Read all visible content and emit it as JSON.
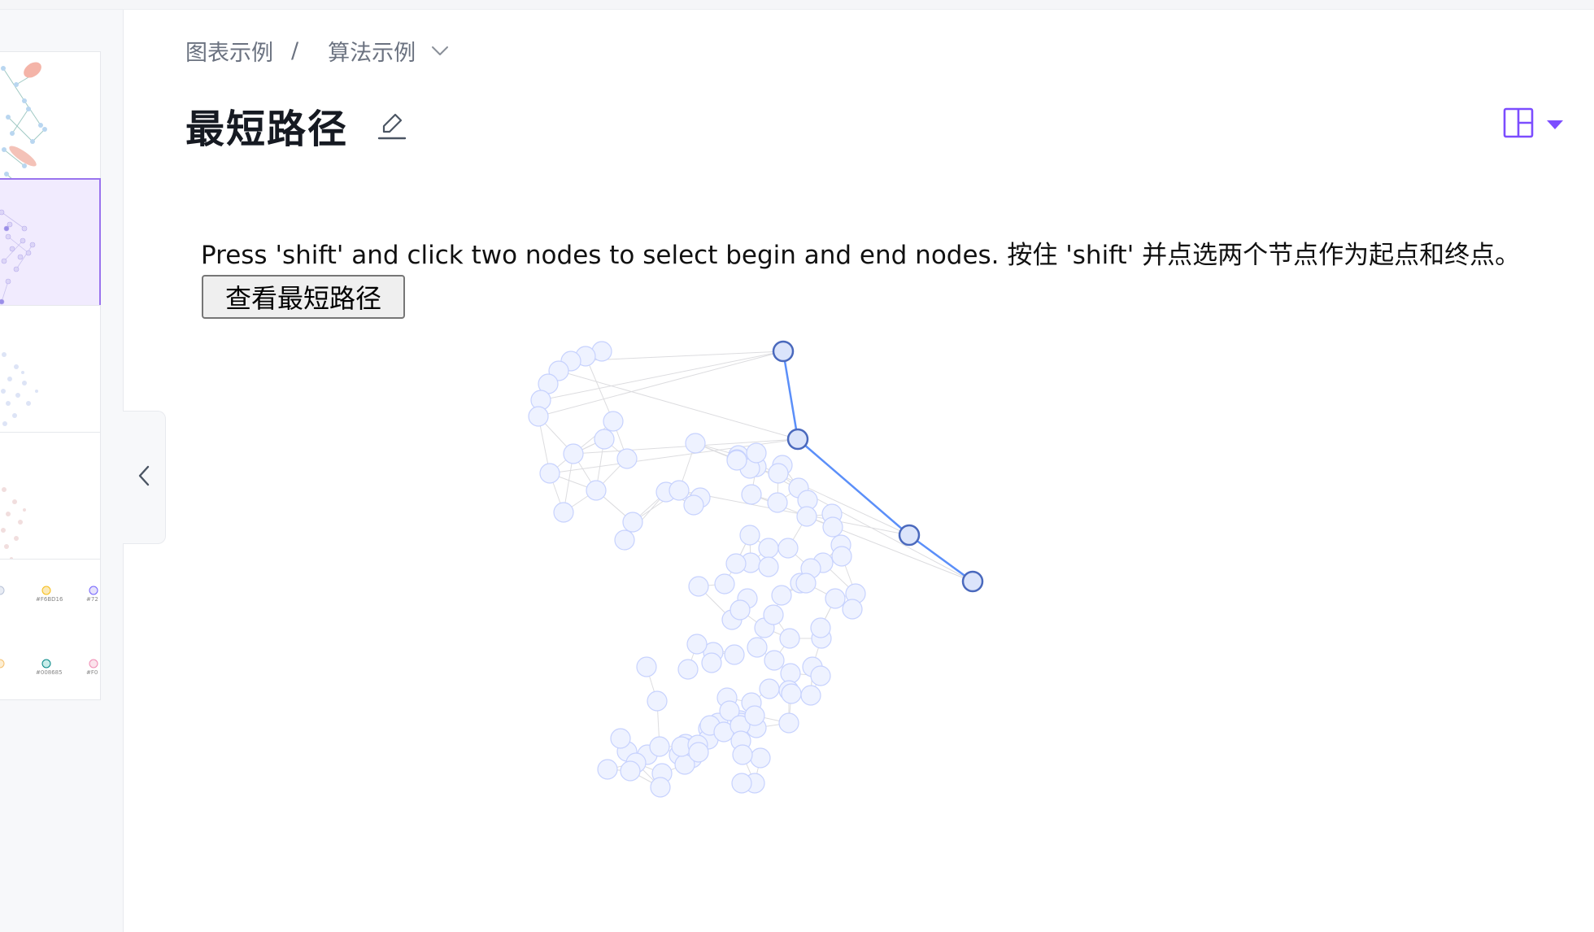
{
  "breadcrumb": {
    "parent": "图表示例",
    "separator": "/",
    "current": "算法示例"
  },
  "page": {
    "title": "最短路径"
  },
  "demo": {
    "instructions": "Press 'shift' and click two nodes to select begin and end nodes. 按住 'shift' 并点选两个节点作为起点和终点。",
    "button_label": "查看最短路径"
  },
  "colors": {
    "accent": "#7c4dff",
    "node_fill": "#eef2ff",
    "node_stroke": "#c7d2fe",
    "edge": "#d4d4d8",
    "path_node_fill": "#dbe4fb",
    "path_node_stroke": "#4a69bd",
    "path_edge": "#5b8ff9"
  },
  "icons": {
    "edit": "pencil-icon",
    "collapse": "chevron-left-icon",
    "layout": "layout-icon",
    "dropdown": "caret-down-icon"
  },
  "thumbnails": {
    "swatch_labels": [
      "#F6BD16",
      "#72",
      "#008685",
      "#F0"
    ]
  }
}
